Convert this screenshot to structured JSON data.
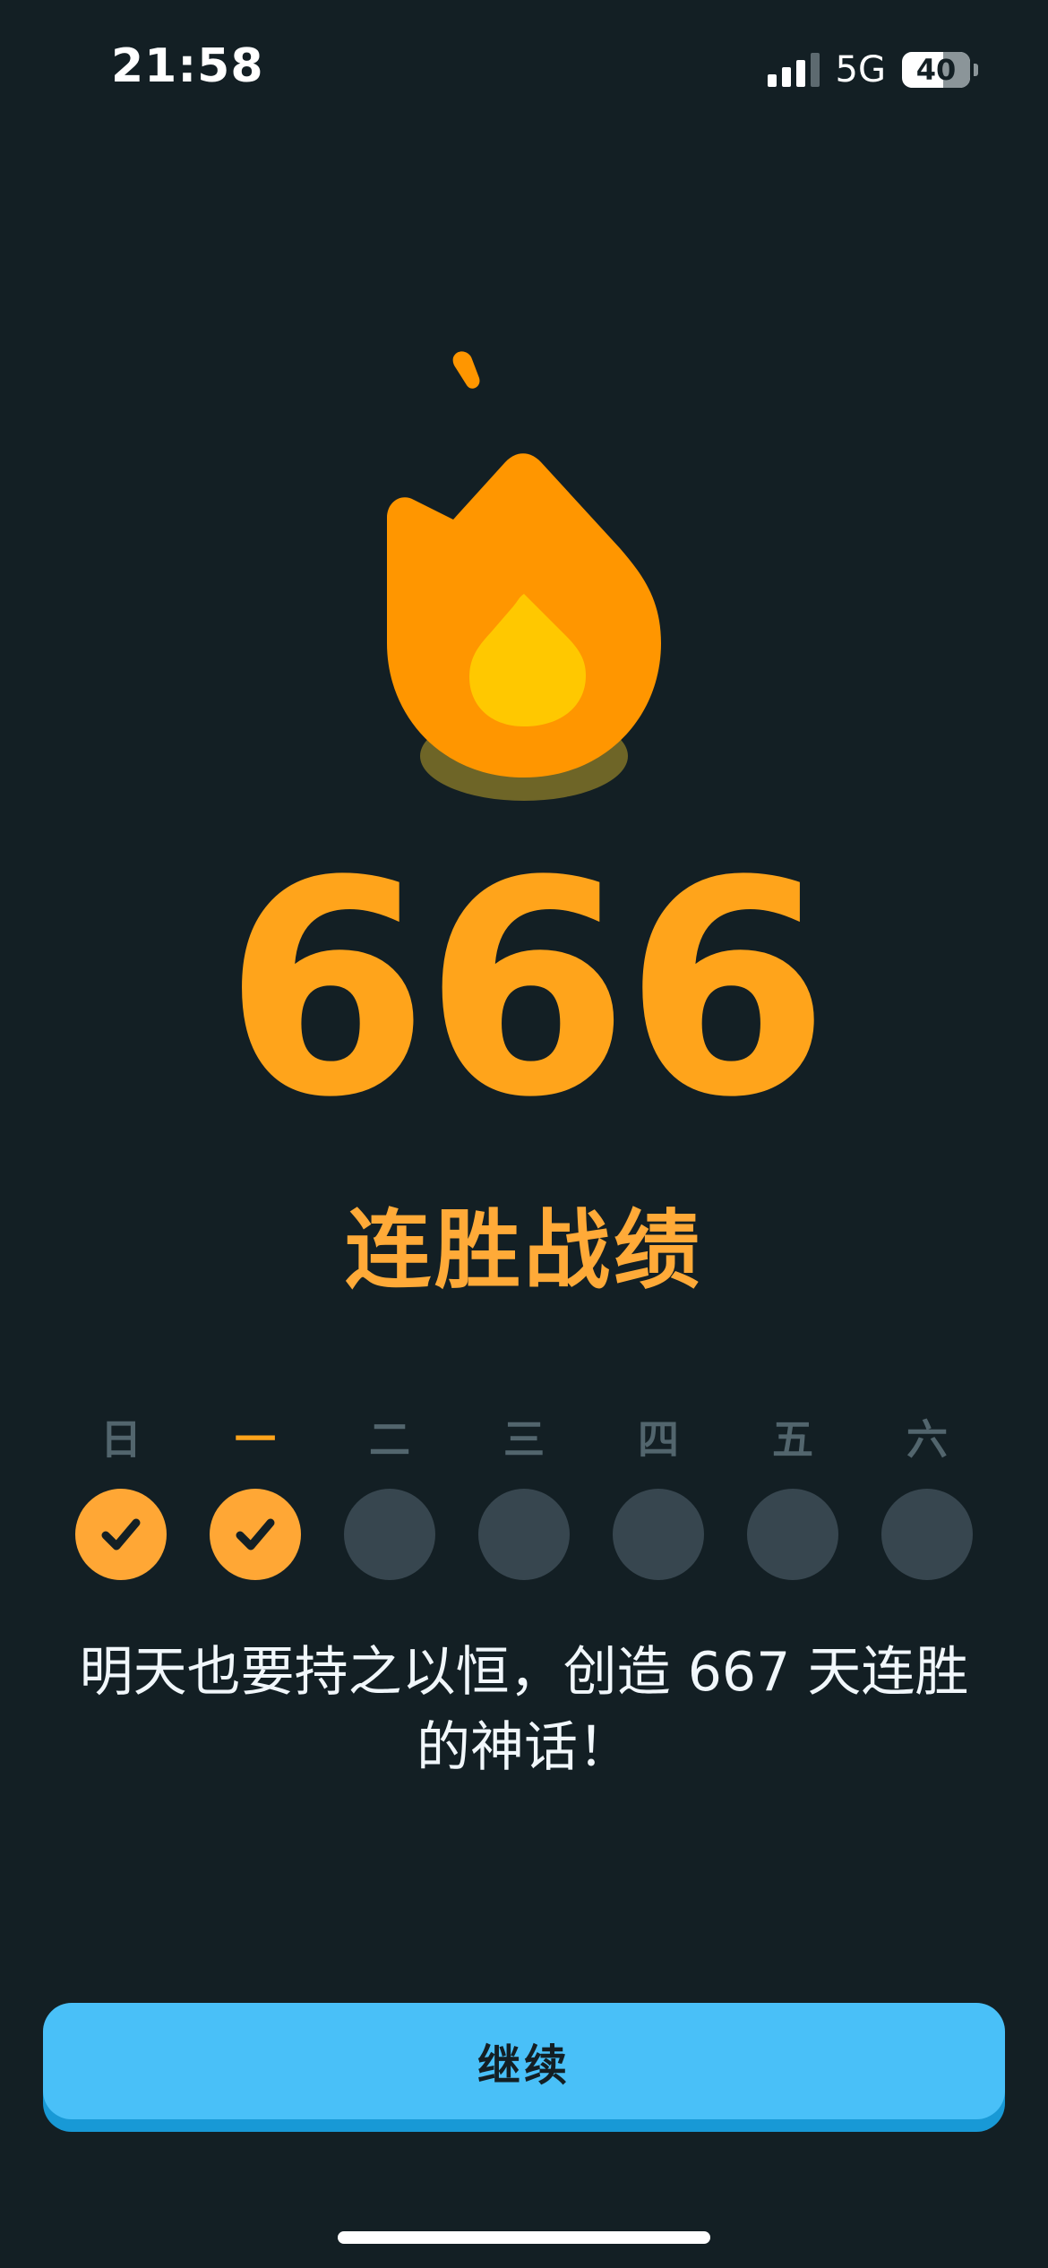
{
  "status_bar": {
    "time": "21:58",
    "network": "5G",
    "battery": "40"
  },
  "streak": {
    "count": "666",
    "label": "连胜战绩"
  },
  "week": {
    "days": [
      {
        "label": "日",
        "done": true,
        "current": false
      },
      {
        "label": "一",
        "done": true,
        "current": true
      },
      {
        "label": "二",
        "done": false,
        "current": false
      },
      {
        "label": "三",
        "done": false,
        "current": false
      },
      {
        "label": "四",
        "done": false,
        "current": false
      },
      {
        "label": "五",
        "done": false,
        "current": false
      },
      {
        "label": "六",
        "done": false,
        "current": false
      }
    ]
  },
  "message": {
    "line1": "明天也要持之以恒，创造 667 天连胜",
    "line2": "的神话！"
  },
  "actions": {
    "continue_label": "继续"
  },
  "colors": {
    "background": "#131F24",
    "streak_orange": "#FFA41B",
    "flame_outer": "#FF9600",
    "flame_inner": "#FFC800",
    "day_done": "#FFA735",
    "day_pending": "#37464F",
    "button": "#49C0F8",
    "button_shadow": "#1899D6"
  },
  "icons": {
    "flame": "flame-icon",
    "check": "check-icon",
    "signal": "cellular-signal-icon",
    "battery": "battery-icon"
  }
}
